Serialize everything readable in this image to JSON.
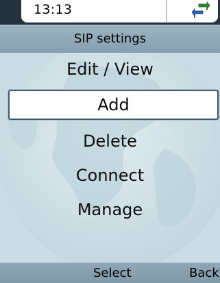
{
  "status": {
    "time": "13:13",
    "sync_icon": "sync-arrows-icon"
  },
  "title": "SIP settings",
  "menu": {
    "items": [
      {
        "label": "Edit / View",
        "selected": false
      },
      {
        "label": "Add",
        "selected": true
      },
      {
        "label": "Delete",
        "selected": false
      },
      {
        "label": "Connect",
        "selected": false
      },
      {
        "label": "Manage",
        "selected": false
      }
    ]
  },
  "softkeys": {
    "left": "Select",
    "right": "Back"
  },
  "colors": {
    "title_bar": "#8fa8b7",
    "content_bg": "#cddfe6",
    "selection_border": "#3e5b6e",
    "softkey_bar": "#86a0af"
  }
}
